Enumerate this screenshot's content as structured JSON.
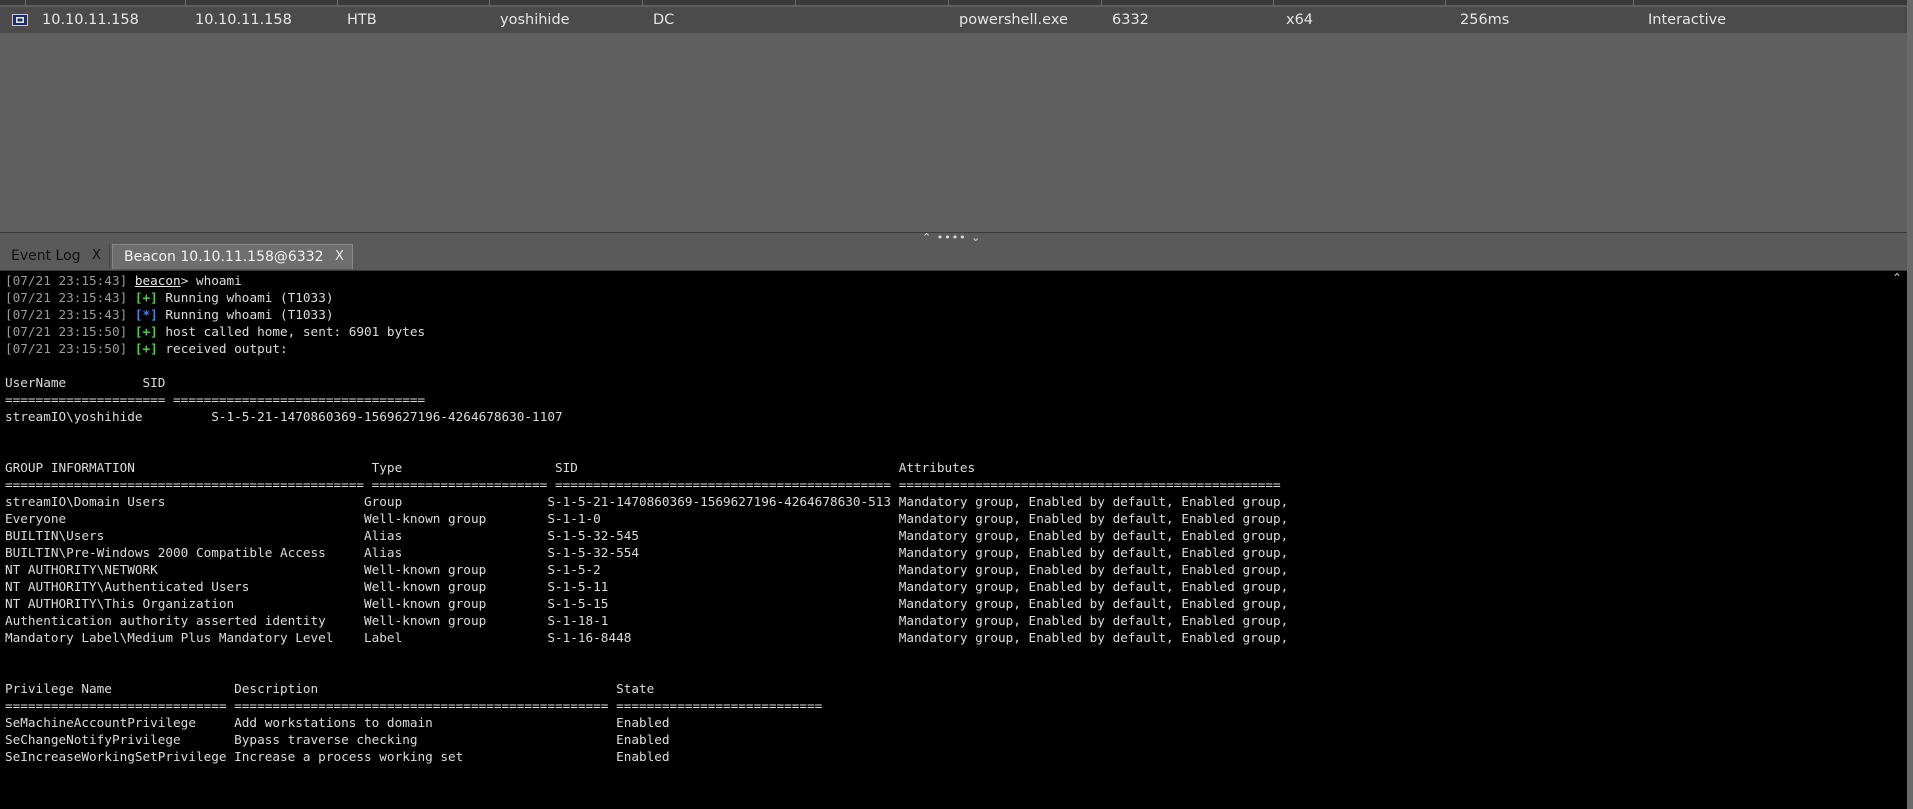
{
  "sessions": {
    "rows": [
      {
        "icon": "beacon-session-icon",
        "external": "10.10.11.158",
        "internal": "10.10.11.158",
        "listener": "HTB",
        "user": "yoshihide",
        "computer": "DC",
        "note": "",
        "process": "powershell.exe",
        "pid": "6332",
        "arch": "x64",
        "last": "256ms",
        "type": "Interactive"
      }
    ]
  },
  "tabs": [
    {
      "label": "Event Log",
      "close": "X",
      "active": false
    },
    {
      "label": "Beacon 10.10.11.158@6332",
      "close": "X",
      "active": true
    }
  ],
  "console": {
    "log": [
      {
        "ts": "[07/21 23:15:43]",
        "prompt": "beacon",
        "cmd": "> whoami"
      },
      {
        "ts": "[07/21 23:15:43]",
        "tag": "[+]",
        "text": " Running whoami (T1033)"
      },
      {
        "ts": "[07/21 23:15:43]",
        "tag": "[*]",
        "text": " Running whoami (T1033)"
      },
      {
        "ts": "[07/21 23:15:50]",
        "tag": "[+]",
        "text": " host called home, sent: 6901 bytes"
      },
      {
        "ts": "[07/21 23:15:50]",
        "tag": "[+]",
        "text": " received output:"
      }
    ],
    "output": [
      "",
      "UserName          SID",
      "===================== =================================",
      "streamIO\\yoshihide         S-1-5-21-1470860369-1569627196-4264678630-1107",
      "",
      "",
      "GROUP INFORMATION                               Type                    SID                                          Attributes",
      "=============================================== ======================= ============================================ ==================================================",
      "streamIO\\Domain Users                          Group                   S-1-5-21-1470860369-1569627196-4264678630-513 Mandatory group, Enabled by default, Enabled group,",
      "Everyone                                       Well-known group        S-1-1-0                                       Mandatory group, Enabled by default, Enabled group,",
      "BUILTIN\\Users                                  Alias                   S-1-5-32-545                                  Mandatory group, Enabled by default, Enabled group,",
      "BUILTIN\\Pre-Windows 2000 Compatible Access     Alias                   S-1-5-32-554                                  Mandatory group, Enabled by default, Enabled group,",
      "NT AUTHORITY\\NETWORK                           Well-known group        S-1-5-2                                       Mandatory group, Enabled by default, Enabled group,",
      "NT AUTHORITY\\Authenticated Users               Well-known group        S-1-5-11                                      Mandatory group, Enabled by default, Enabled group,",
      "NT AUTHORITY\\This Organization                 Well-known group        S-1-5-15                                      Mandatory group, Enabled by default, Enabled group,",
      "Authentication authority asserted identity     Well-known group        S-1-18-1                                      Mandatory group, Enabled by default, Enabled group,",
      "Mandatory Label\\Medium Plus Mandatory Level    Label                   S-1-16-8448                                   Mandatory group, Enabled by default, Enabled group,",
      "",
      "",
      "Privilege Name                Description                                       State",
      "============================= ================================================= ===========================",
      "SeMachineAccountPrivilege     Add workstations to domain                        Enabled",
      "SeChangeNotifyPrivilege       Bypass traverse checking                          Enabled",
      "SeIncreaseWorkingSetPrivilege Increase a process working set                    Enabled"
    ]
  },
  "colors": {
    "success_tag": "#48d048",
    "info_tag": "#4a7eff",
    "console_bg": "#000000",
    "session_row_bg": "#4b4b4b"
  }
}
